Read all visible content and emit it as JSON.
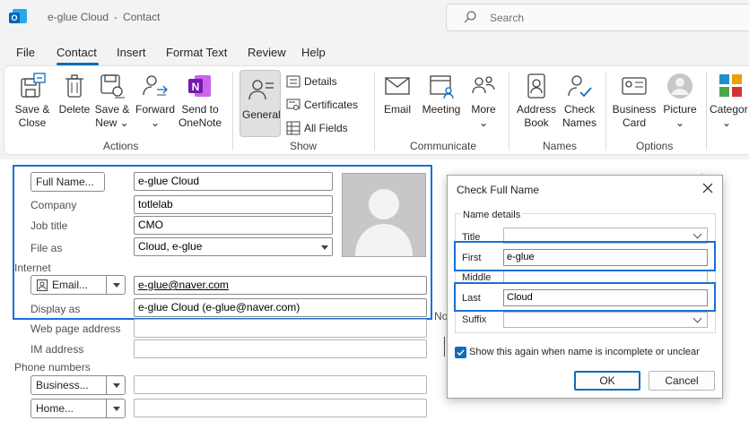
{
  "window": {
    "app": "e-glue Cloud",
    "separator": "-",
    "title": "Contact"
  },
  "search": {
    "placeholder": "Search"
  },
  "menu": {
    "tabs": [
      "File",
      "Contact",
      "Insert",
      "Format Text",
      "Review",
      "Help"
    ],
    "active": "Contact"
  },
  "ribbon": {
    "actions": {
      "save_close": [
        "Save &",
        "Close"
      ],
      "delete": "Delete",
      "save_new": [
        "Save &",
        "New"
      ],
      "forward": "Forward",
      "send_onenote": [
        "Send to",
        "OneNote"
      ],
      "label": "Actions"
    },
    "show": {
      "general": "General",
      "details": "Details",
      "certificates": "Certificates",
      "all_fields": "All Fields",
      "label": "Show"
    },
    "communicate": {
      "email": "Email",
      "meeting": "Meeting",
      "more": "More",
      "label": "Communicate"
    },
    "names": {
      "address_book": [
        "Address",
        "Book"
      ],
      "check_names": [
        "Check",
        "Names"
      ],
      "label": "Names"
    },
    "options": {
      "business_card": [
        "Business",
        "Card"
      ],
      "picture": "Picture",
      "label": "Options"
    },
    "tags": {
      "categorize": "Categor"
    },
    "chevron": "⌄"
  },
  "form": {
    "full_name_button": "Full Name...",
    "full_name": "e-glue Cloud",
    "company_label": "Company",
    "company": "totlelab",
    "job_title_label": "Job title",
    "job_title": "CMO",
    "file_as_label": "File as",
    "file_as": "Cloud, e-glue",
    "internet_label": "Internet",
    "email_button": "Email...",
    "email": "e-glue@naver.com",
    "display_as_label": "Display as",
    "display_as": "e-glue Cloud (e-glue@naver.com)",
    "web_page_label": "Web page address",
    "im_label": "IM address",
    "phone_label": "Phone numbers",
    "business_button": "Business...",
    "home_button": "Home...",
    "notes_fragment": "No"
  },
  "dialog": {
    "title": "Check Full Name",
    "group_label": "Name details",
    "title_label": "Title",
    "title_value": "",
    "first_label": "First",
    "first_value": "e-glue",
    "middle_label": "Middle",
    "middle_value": "",
    "last_label": "Last",
    "last_value": "Cloud",
    "suffix_label": "Suffix",
    "suffix_value": "",
    "show_again_label": "Show this again when name is incomplete or unclear",
    "show_again_checked": true,
    "ok": "OK",
    "cancel": "Cancel"
  },
  "colors": {
    "accent": "#0f6cbd",
    "highlight": "#1a6fd6"
  }
}
